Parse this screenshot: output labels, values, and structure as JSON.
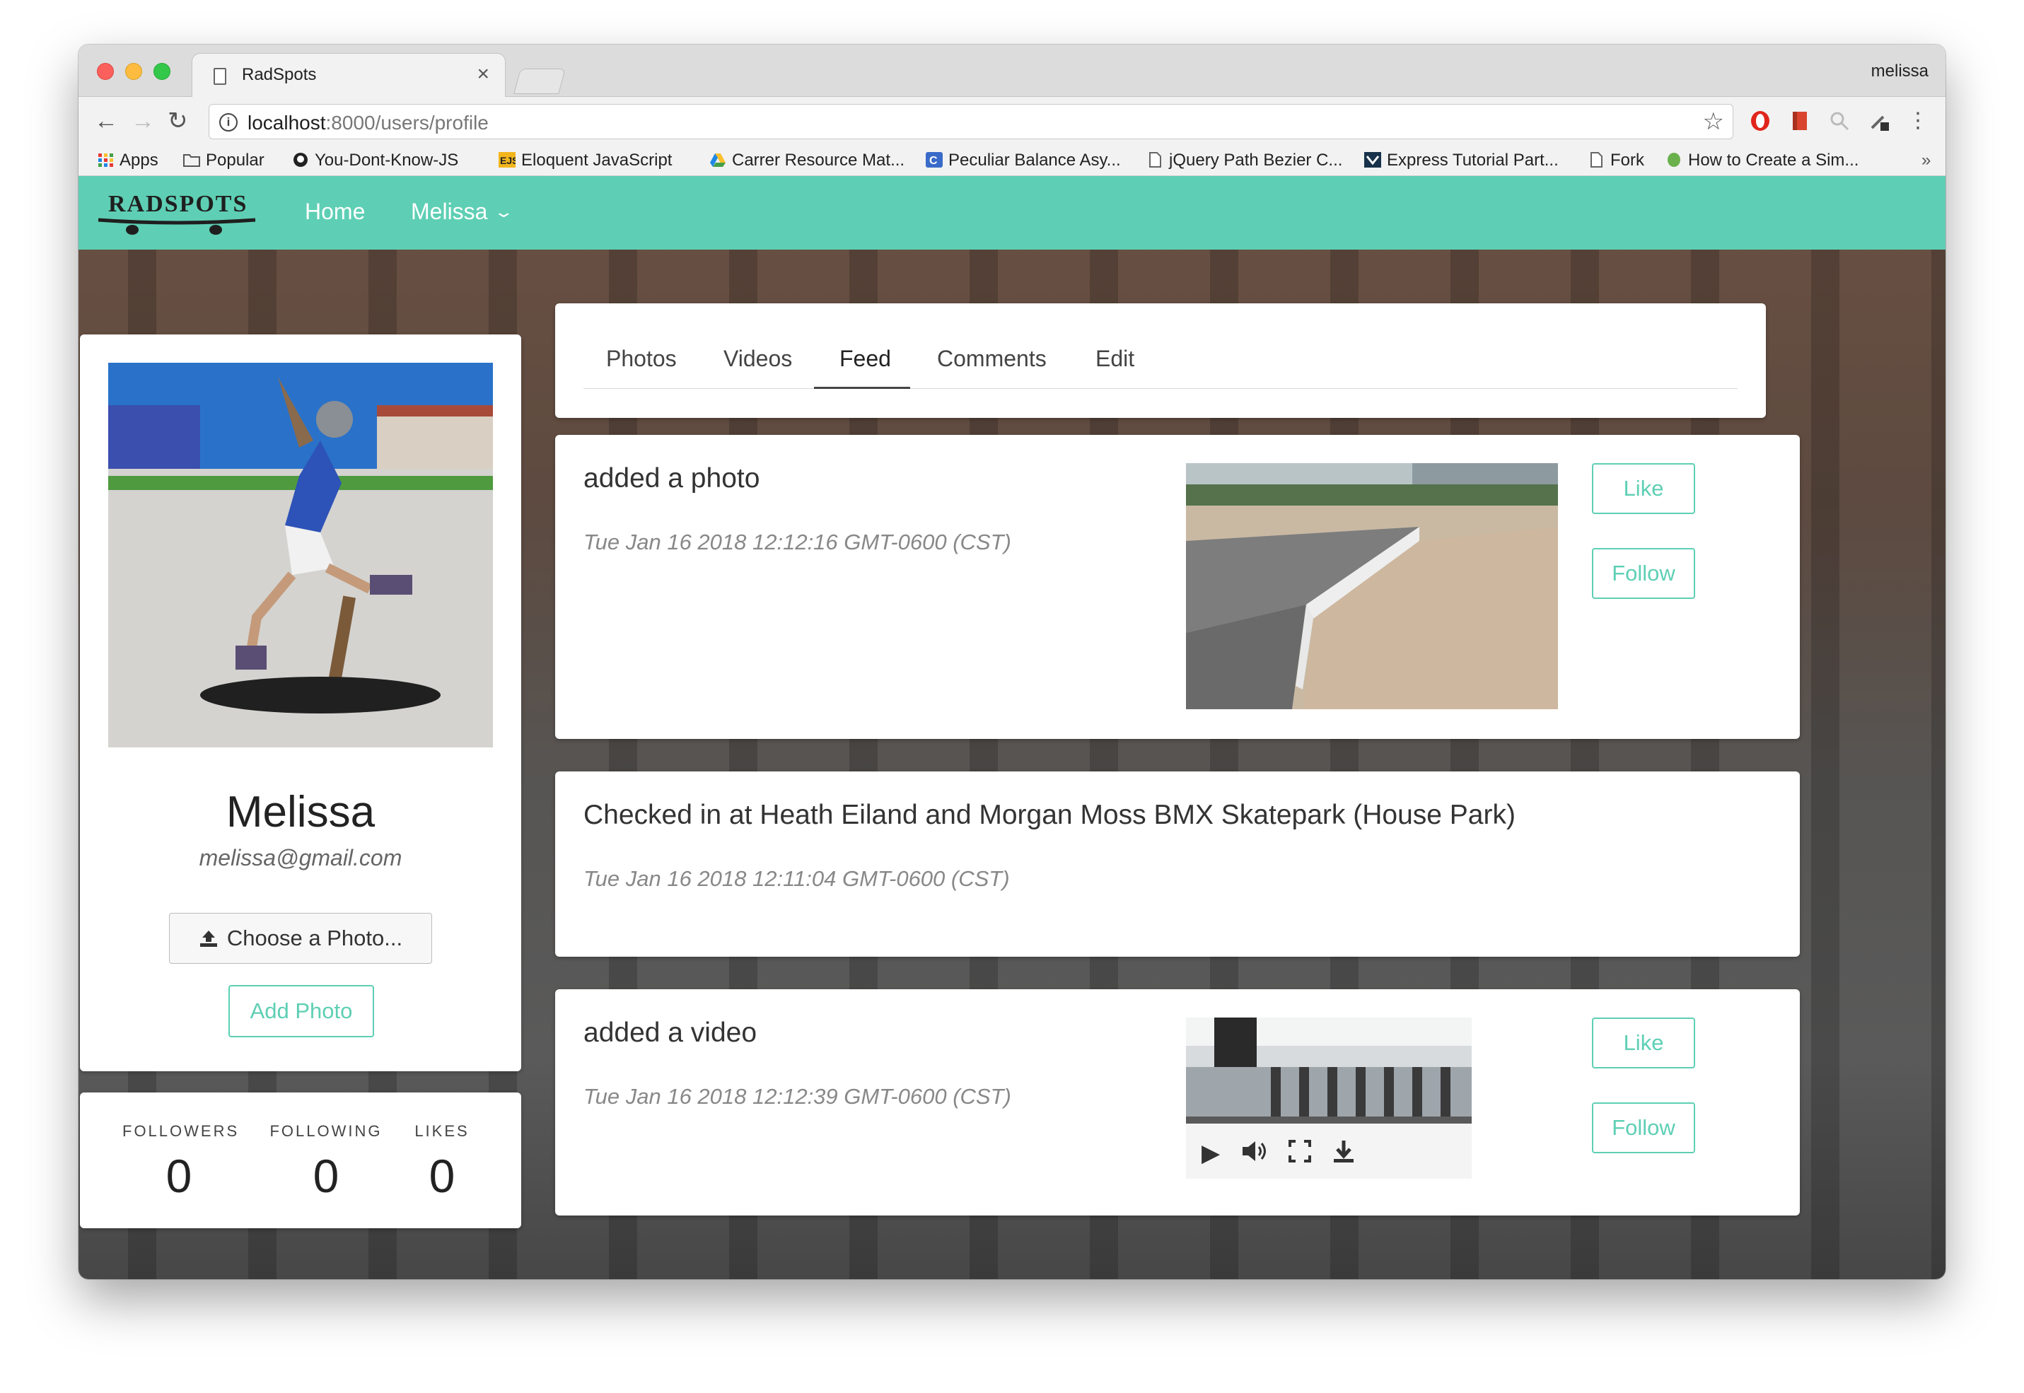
{
  "browser": {
    "tab_title": "RadSpots",
    "tab_close": "×",
    "profile": "melissa",
    "url_host": "localhost",
    "url_path": ":8000/users/profile",
    "back": "←",
    "forward": "→",
    "reload": "↻",
    "star": "☆",
    "bookmarks_overflow": "»",
    "bookmarks": [
      {
        "label": "Apps",
        "icon": "apps-grid-icon"
      },
      {
        "label": "Popular",
        "icon": "folder-icon"
      },
      {
        "label": "You-Dont-Know-JS",
        "icon": "github-icon"
      },
      {
        "label": "Eloquent JavaScript",
        "icon": "ejs-icon"
      },
      {
        "label": "Carrer Resource Mat...",
        "icon": "drive-icon"
      },
      {
        "label": "Peculiar Balance Asy...",
        "icon": "c-icon"
      },
      {
        "label": "jQuery Path Bezier C...",
        "icon": "page-icon"
      },
      {
        "label": "Express Tutorial Part...",
        "icon": "mdn-icon"
      },
      {
        "label": "Fork",
        "icon": "page-icon"
      },
      {
        "label": "How to Create a Sim...",
        "icon": "leaf-icon"
      }
    ]
  },
  "app": {
    "logo_text": "RADSPOTS",
    "nav_home": "Home",
    "nav_user": "Melissa",
    "brand_color": "#5ecfb4"
  },
  "profile": {
    "name": "Melissa",
    "email": "melissa@gmail.com",
    "choose_photo": "Choose a Photo...",
    "add_photo": "Add Photo",
    "stats": [
      {
        "label": "FOLLOWERS",
        "value": "0"
      },
      {
        "label": "FOLLOWING",
        "value": "0"
      },
      {
        "label": "LIKES",
        "value": "0"
      }
    ]
  },
  "tabs": [
    "Photos",
    "Videos",
    "Feed",
    "Comments",
    "Edit"
  ],
  "active_tab": "Feed",
  "feed": [
    {
      "title": "added a photo",
      "date": "Tue Jan 16 2018 12:12:16 GMT-0600 (CST)",
      "like": "Like",
      "follow": "Follow"
    },
    {
      "title": "Checked in at Heath Eiland and Morgan Moss BMX Skatepark (House Park)",
      "date": "Tue Jan 16 2018 12:11:04 GMT-0600 (CST)"
    },
    {
      "title": "added a video",
      "date": "Tue Jan 16 2018 12:12:39 GMT-0600 (CST)",
      "like": "Like",
      "follow": "Follow"
    }
  ]
}
